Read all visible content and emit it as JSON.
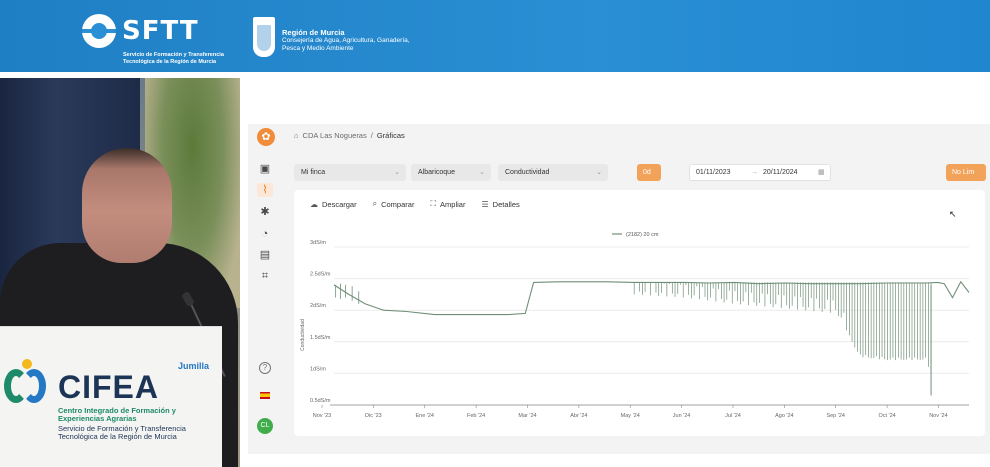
{
  "banner": {
    "sftt_name": "SFTT",
    "sftt_subtitle": "Servicio de Formación y Transferencia Tecnológica de la Región de Murcia",
    "region_title": "Región de Murcia",
    "region_subtitle": "Consejería de Agua, Agricultura, Ganadería, Pesca y Medio Ambiente"
  },
  "podium": {
    "name": "CIFEA",
    "location": "Jumilla",
    "subtitle1": "Centro Integrado de Formación y Experiencias Agrarias",
    "subtitle2": "Servicio de Formación y Transferencia Tecnológica de la Región de Murcia"
  },
  "sidebar": {
    "logo_glyph": "✿",
    "icons": [
      "image-icon",
      "chart-icon",
      "bug-icon",
      "bell-icon",
      "report-icon",
      "layout-icon"
    ],
    "avatar_initials": "CL",
    "help_glyph": "?"
  },
  "breadcrumb": {
    "farm": "CDA Las Nogueras",
    "separator": "/",
    "current": "Gráficas"
  },
  "filters": {
    "farm": "Mi finca",
    "crop": "Albaricoque",
    "variable": "Conductividad",
    "aggregation": "0d",
    "date_from": "01/11/2023",
    "date_arrow": "→",
    "date_to": "20/11/2024",
    "limits": "No Lim"
  },
  "toolbar": {
    "download": "Descargar",
    "compare": "Comparar",
    "expand": "Ampliar",
    "details": "Detalles"
  },
  "chart_data": {
    "type": "line",
    "title": "",
    "ylabel": "Conductividad",
    "xlabel": "",
    "legend": [
      "(2182) 20 cm"
    ],
    "legend_position": "top-center",
    "ylim": [
      0.5,
      3
    ],
    "y_ticks": [
      "3dS/m",
      "2.5dS/m",
      "2dS/m",
      "1.5dS/m",
      "1dS/m",
      "0.5dS/m"
    ],
    "y_tick_values": [
      3,
      2.5,
      2,
      1.5,
      1,
      0.5
    ],
    "x_ticks": [
      "Nov '23",
      "Dic '23",
      "Ene '24",
      "Feb '24",
      "Mar '24",
      "Abr '24",
      "May '24",
      "Jun '24",
      "Jul '24",
      "Ago '24",
      "Sep '24",
      "Oct '24",
      "Nov '24"
    ],
    "grid": true,
    "color": "#6f8f78",
    "series": [
      {
        "name": "(2182) 20 cm",
        "x": [
          "2023-11-01",
          "2023-11-10",
          "2023-11-20",
          "2023-12-01",
          "2023-12-15",
          "2024-01-01",
          "2024-01-15",
          "2024-02-01",
          "2024-02-15",
          "2024-02-25",
          "2024-03-01",
          "2024-03-15",
          "2024-04-01",
          "2024-04-15",
          "2024-05-01",
          "2024-05-15",
          "2024-06-01",
          "2024-06-15",
          "2024-07-01",
          "2024-07-15",
          "2024-08-01",
          "2024-08-15",
          "2024-09-01",
          "2024-09-15",
          "2024-10-01",
          "2024-10-15",
          "2024-10-25",
          "2024-11-01",
          "2024-11-05",
          "2024-11-10",
          "2024-11-15",
          "2024-11-20"
        ],
        "y": [
          2.4,
          2.25,
          2.1,
          2.0,
          1.98,
          1.93,
          1.93,
          1.93,
          1.93,
          1.95,
          2.44,
          2.45,
          2.45,
          2.45,
          2.44,
          2.44,
          2.44,
          2.43,
          2.44,
          2.42,
          2.43,
          2.42,
          2.42,
          2.42,
          2.43,
          2.43,
          2.43,
          2.44,
          2.42,
          2.2,
          2.45,
          2.28
        ],
        "min_envelope_x": [
          "2024-05-01",
          "2024-06-01",
          "2024-07-01",
          "2024-08-01",
          "2024-09-01",
          "2024-09-15",
          "2024-10-01",
          "2024-10-15",
          "2024-10-25",
          "2024-11-01"
        ],
        "min_envelope_y": [
          2.2,
          2.15,
          2.05,
          1.98,
          1.9,
          1.25,
          1.2,
          1.2,
          1.2,
          0.65
        ]
      }
    ]
  }
}
